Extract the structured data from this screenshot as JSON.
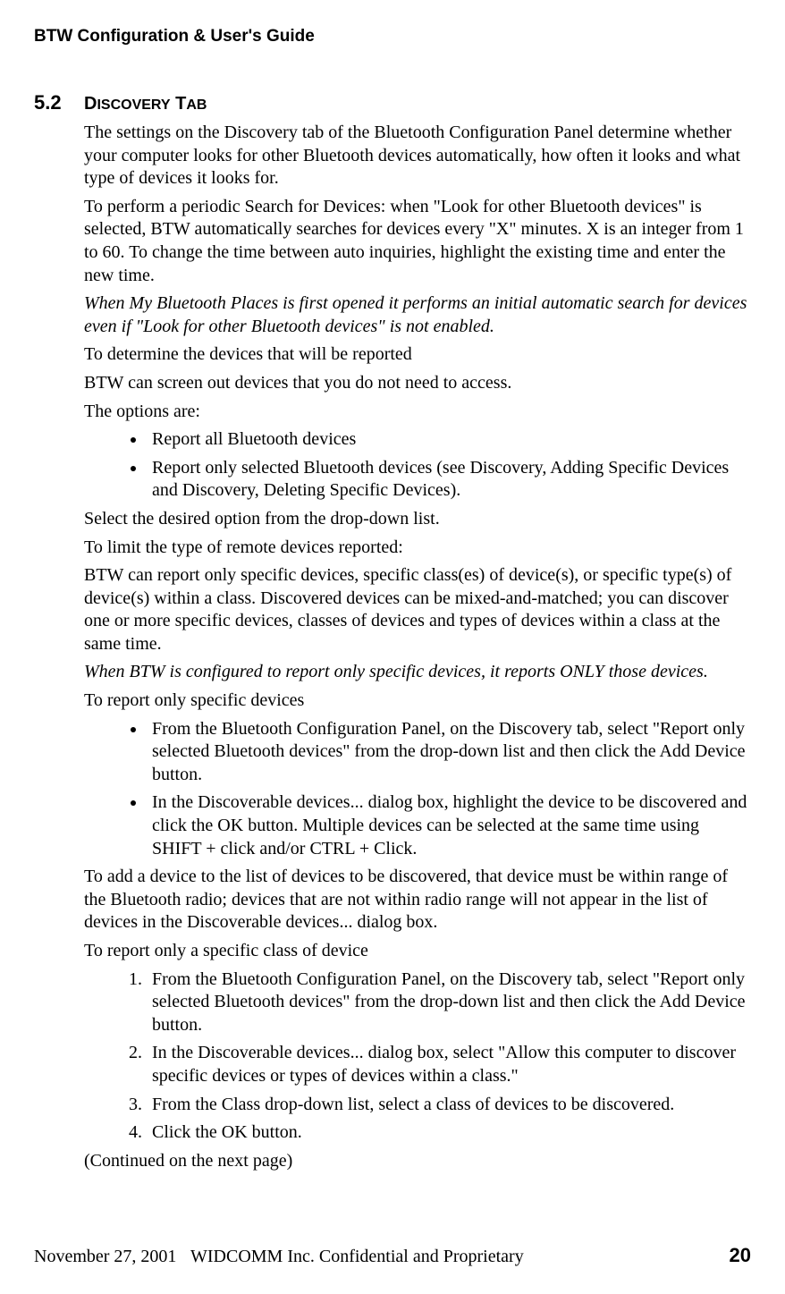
{
  "header": {
    "title": "BTW Configuration & User's Guide"
  },
  "section": {
    "number": "5.2",
    "title_prefix": "D",
    "title_rest_1": "ISCOVERY",
    "title_space": " T",
    "title_rest_2": "AB"
  },
  "body": {
    "p1": "The settings on the Discovery tab of the Bluetooth Configuration Panel determine whether your computer looks for other Bluetooth devices automatically, how often it looks and what type of devices it looks for.",
    "p2": "To perform a periodic Search for Devices: when \"Look for other Bluetooth devices\" is selected, BTW automatically searches for devices every \"X\" minutes. X is an integer from 1 to 60. To change the time between auto inquiries, highlight the existing time and enter the new time.",
    "p3": "When My Bluetooth Places is first opened it performs an initial automatic search for devices even if \"Look for other Bluetooth devices\" is not enabled.",
    "p4": "To determine the devices that will be reported",
    "p5": "BTW can screen out devices that you do not need to access.",
    "p6": "The options are:",
    "bullets1": [
      "Report all Bluetooth devices",
      "Report only selected Bluetooth devices (see Discovery, Adding Specific Devices and Discovery, Deleting Specific Devices)."
    ],
    "p7": "Select the desired option from the drop-down list.",
    "p8": "To limit the type of remote devices reported:",
    "p9": "BTW can report only specific devices, specific class(es) of device(s), or specific type(s) of device(s) within a class. Discovered devices can be mixed-and-matched; you can discover one or more specific devices, classes of devices and types of devices within a class at the same time.",
    "p10": "When BTW is configured to report only specific devices, it reports ONLY those devices.",
    "p11": "To report only specific devices",
    "bullets2": [
      "From the Bluetooth Configuration Panel, on the Discovery tab, select \"Report only selected Bluetooth devices\" from the drop-down list and then click the Add Device button.",
      "In the Discoverable devices... dialog box, highlight the device to be discovered and click the OK button. Multiple devices can be selected at the same time using SHIFT + click and/or CTRL + Click."
    ],
    "p12": "To add a device to the list of devices to be discovered, that device must be within range of the Bluetooth radio; devices that are not within radio range will not appear in the list of devices in the Discoverable devices... dialog box.",
    "p13": "To report only a specific class of device",
    "ol1": [
      "From the Bluetooth Configuration Panel, on the Discovery tab, select \"Report only selected Bluetooth devices\" from the drop-down list and then click the Add Device button.",
      "In the Discoverable devices... dialog box, select \"Allow this computer to discover specific devices or types of devices within a class.\"",
      "From the Class drop-down list, select a class of devices to be discovered.",
      "Click the OK button."
    ],
    "p14": "(Continued on the next page)"
  },
  "footer": {
    "date": "November 27, 2001",
    "center": "WIDCOMM Inc. Confidential and Proprietary",
    "page": "20"
  }
}
